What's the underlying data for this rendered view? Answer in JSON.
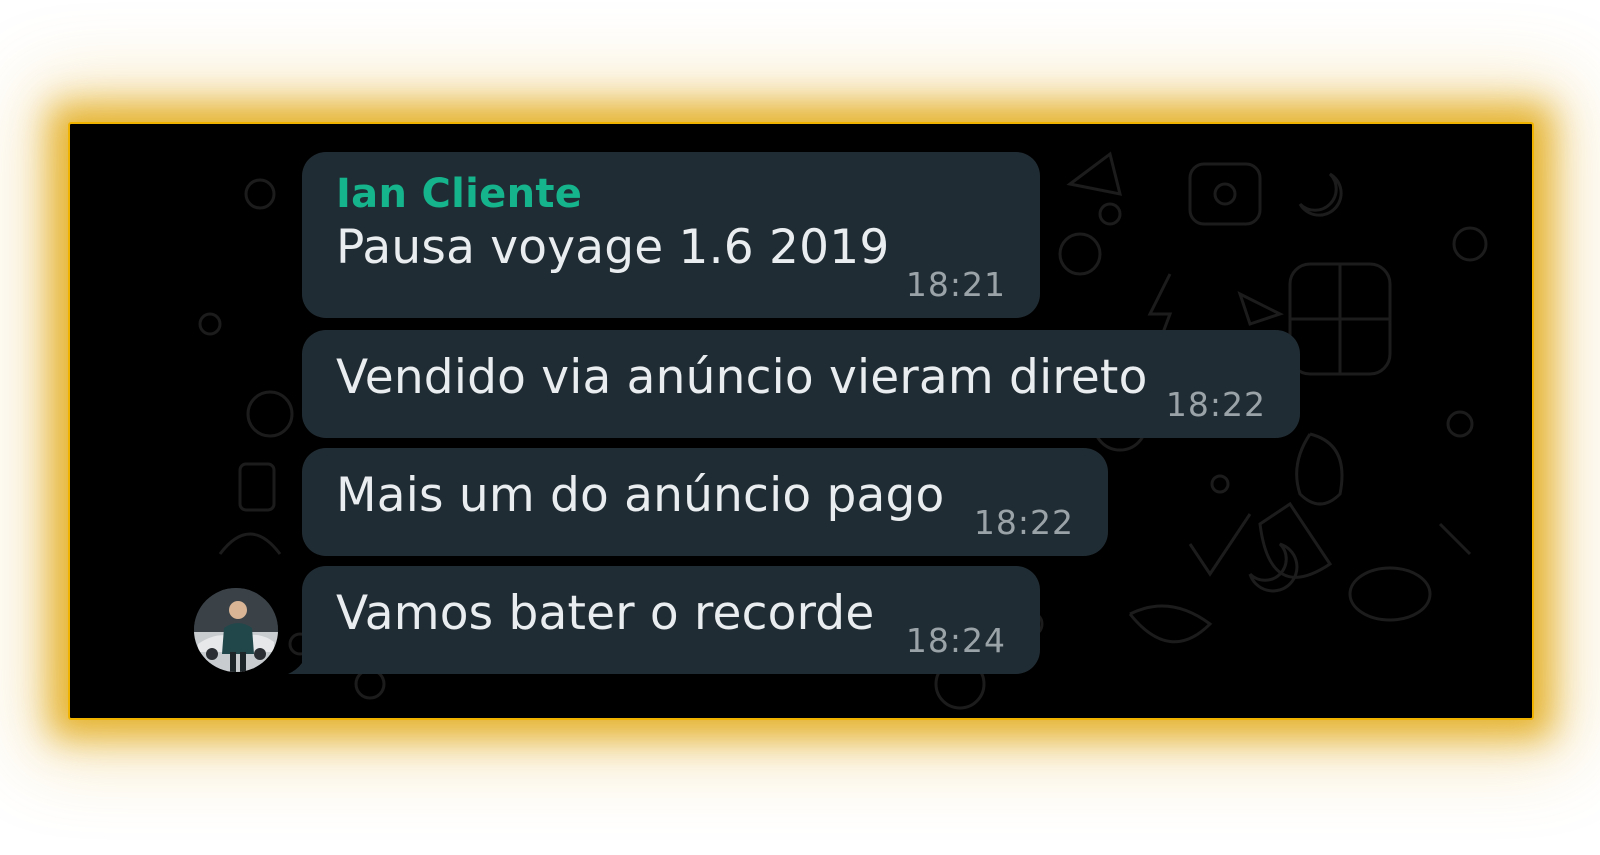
{
  "chat": {
    "messages": [
      {
        "sender": "Ian Cliente",
        "text": "Pausa voyage 1.6 2019",
        "time": "18:21"
      },
      {
        "text": "Vendido via anúncio vieram direto",
        "time": "18:22"
      },
      {
        "text": "Mais um do anúncio pago",
        "time": "18:22"
      },
      {
        "text": "Vamos bater o recorde",
        "time": "18:24"
      }
    ],
    "avatar_icon": "user-photo-avatar"
  },
  "colors": {
    "frame_border": "#f0b400",
    "glow": "#dfa200",
    "background": "#000000",
    "bubble": "#202c33",
    "sender_name": "#16b48d",
    "message_text": "#e9edef",
    "timestamp": "#9aa3a8"
  }
}
